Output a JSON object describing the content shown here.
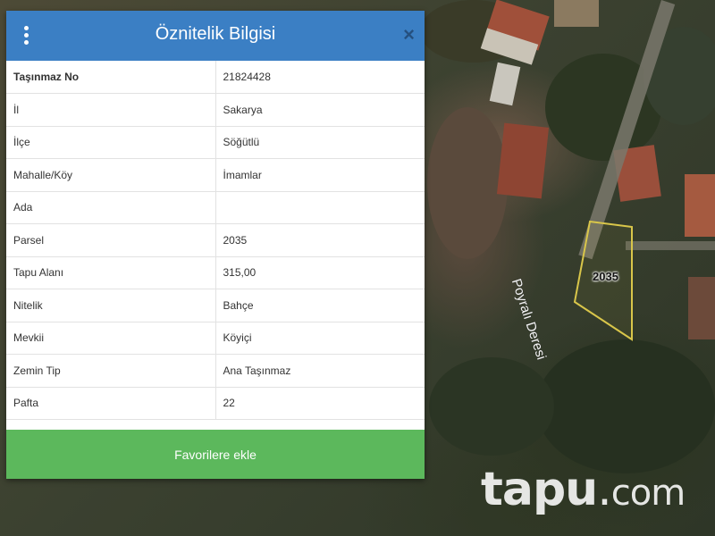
{
  "dialog": {
    "title": "Öznitelik Bilgisi",
    "close_symbol": "×",
    "menu_icon": "vertical-dots-icon",
    "rows": [
      {
        "key": "Taşınmaz No",
        "value": "21824428"
      },
      {
        "key": "İl",
        "value": "Sakarya"
      },
      {
        "key": "İlçe",
        "value": "Söğütlü"
      },
      {
        "key": "Mahalle/Köy",
        "value": "İmamlar"
      },
      {
        "key": "Ada",
        "value": ""
      },
      {
        "key": "Parsel",
        "value": "2035"
      },
      {
        "key": "Tapu Alanı",
        "value": "315,00"
      },
      {
        "key": "Nitelik",
        "value": "Bahçe"
      },
      {
        "key": "Mevkii",
        "value": "Köyiçi"
      },
      {
        "key": "Zemin Tip",
        "value": "Ana Taşınmaz"
      },
      {
        "key": "Pafta",
        "value": "22"
      }
    ],
    "favorite_button": "Favorilere ekle"
  },
  "map": {
    "parcel_label": "2035",
    "stream_label": "Poyralı Deresi",
    "parcel_outline_color": "#d9c64a"
  },
  "watermark": {
    "brand": "tapu",
    "dot": ".",
    "tld": "com"
  },
  "colors": {
    "header": "#3b7fc4",
    "button": "#5cb85c"
  }
}
